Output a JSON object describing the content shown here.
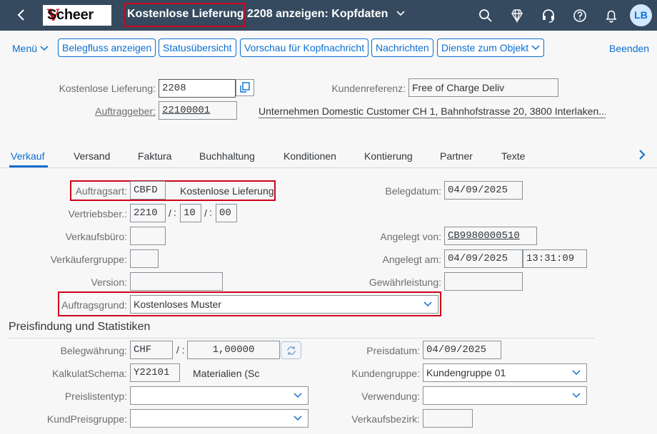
{
  "header": {
    "back_label": "‹",
    "logo_mark": "V",
    "logo_text": "Scheer",
    "title": "Kostenlose Lieferung 2208 anzeigen: Kopfdaten",
    "title_chevron": "⌵",
    "icons": [
      "search-icon",
      "diamond-icon",
      "headset-icon",
      "help-icon",
      "bell-icon"
    ],
    "avatar_initials": "LB"
  },
  "toolbar": {
    "menu_label": "Menü",
    "buttons": [
      "Belegfluss anzeigen",
      "Statusübersicht",
      "Vorschau für Kopfnachricht",
      "Nachrichten",
      "Dienste zum Objekt"
    ],
    "end_label": "Beenden"
  },
  "header_fields": {
    "delivery_label": "Kostenlose Lieferung:",
    "delivery_value": "2208",
    "customer_ref_label": "Kundenreferenz:",
    "customer_ref_value": "Free of Charge Deliv",
    "orderer_label": "Auftraggeber:",
    "orderer_value": "22100001",
    "orderer_desc": "Unternehmen Domestic Customer CH 1, Bahnhofstrasse 20, 3800 Interlaken..."
  },
  "tabs": [
    "Verkauf",
    "Versand",
    "Faktura",
    "Buchhaltung",
    "Konditionen",
    "Kontierung",
    "Partner",
    "Texte"
  ],
  "sales": {
    "order_type_label": "Auftragsart:",
    "order_type_value": "CBFD",
    "order_type_desc": "Kostenlose Lieferung",
    "sales_area_label": "Vertriebsber.:",
    "sales_org": "2210",
    "distribution_channel": "10",
    "division": "00",
    "sales_office_label": "Verkaufsbüro:",
    "sales_group_label": "Verkäufergruppe:",
    "version_label": "Version:",
    "order_reason_label": "Auftragsgrund:",
    "order_reason_value": "Kostenloses Muster",
    "doc_date_label": "Belegdatum:",
    "doc_date_value": "04/09/2025",
    "created_by_label": "Angelegt von:",
    "created_by_value": "CB9980000510",
    "created_on_label": "Angelegt am:",
    "created_on_date": "04/09/2025",
    "created_on_time": "13:31:09",
    "warranty_label": "Gewährleistung:"
  },
  "pricing": {
    "section_title": "Preisfindung und Statistiken",
    "currency_label": "Belegwährung:",
    "currency_value": "CHF",
    "rate_value": "1,00000",
    "schema_label": "KalkulatSchema:",
    "schema_value": "Y22101",
    "schema_desc": "Materialien (Sc",
    "pricelist_label": "Preislistentyp:",
    "custprice_label": "KundPreisgruppe:",
    "price_date_label": "Preisdatum:",
    "price_date_value": "04/09/2025",
    "custgroup_label": "Kundengruppe:",
    "custgroup_value": "Kundengruppe 01",
    "usage_label": "Verwendung:",
    "district_label": "Verkaufsbezirk:"
  },
  "colors": {
    "shell": "#354a5f",
    "accent": "#0a6ed1",
    "highlight": "#d0021b"
  }
}
